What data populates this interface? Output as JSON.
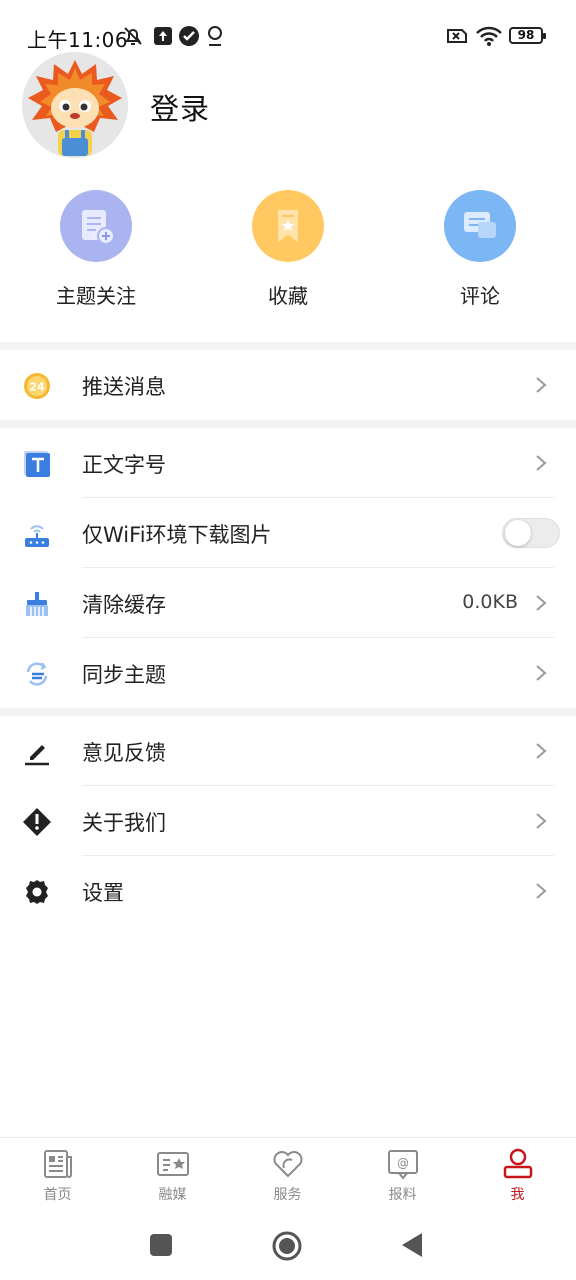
{
  "status_bar": {
    "time": "上午11:06",
    "battery": "98"
  },
  "profile": {
    "login_label": "登录"
  },
  "quick_actions": [
    {
      "label": "主题关注",
      "icon": "topic-follow-icon",
      "color": "#a9b4f2"
    },
    {
      "label": "收藏",
      "icon": "bookmark-icon",
      "color": "#ffc861"
    },
    {
      "label": "评论",
      "icon": "comment-icon",
      "color": "#7db6f4"
    }
  ],
  "menu": {
    "push": {
      "label": "推送消息",
      "icon": "push-24-icon"
    },
    "font_size": {
      "label": "正文字号",
      "icon": "text-size-icon"
    },
    "wifi_images": {
      "label": "仅WiFi环境下载图片",
      "icon": "router-icon",
      "enabled": false
    },
    "clear_cache": {
      "label": "清除缓存",
      "value": "0.0KB",
      "icon": "broom-icon"
    },
    "sync_topics": {
      "label": "同步主题",
      "icon": "sync-icon"
    },
    "feedback": {
      "label": "意见反馈",
      "icon": "pen-icon"
    },
    "about": {
      "label": "关于我们",
      "icon": "info-diamond-icon"
    },
    "settings": {
      "label": "设置",
      "icon": "gear-icon"
    }
  },
  "bottom_nav": [
    {
      "label": "首页",
      "icon": "newspaper-icon"
    },
    {
      "label": "融媒",
      "icon": "media-card-icon"
    },
    {
      "label": "服务",
      "icon": "heart-icon"
    },
    {
      "label": "报料",
      "icon": "report-at-icon"
    },
    {
      "label": "我",
      "icon": "person-icon",
      "active": true
    }
  ],
  "colors": {
    "accent_red": "#c8161d",
    "icon_blue": "#3a7ee0",
    "push_orange": "#f7b733"
  }
}
